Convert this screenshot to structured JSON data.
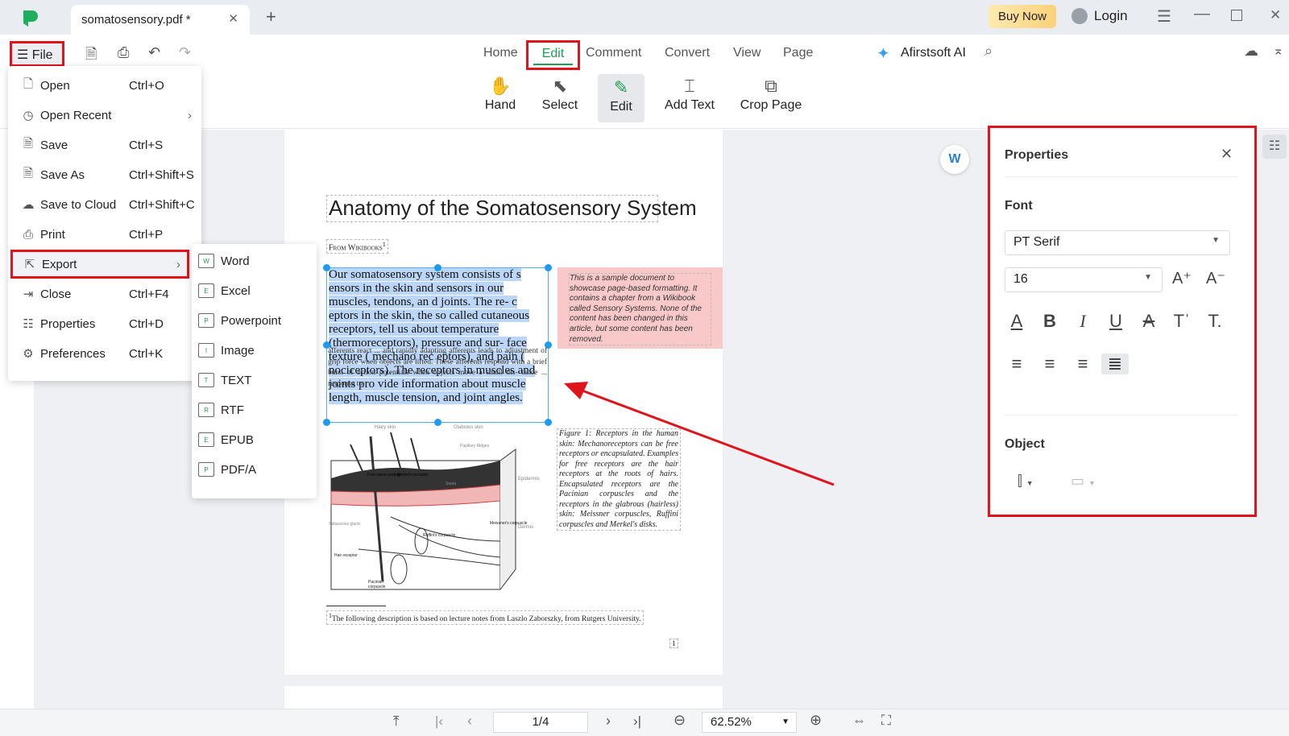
{
  "titlebar": {
    "tab_title": "somatosensory.pdf *",
    "buy_now": "Buy Now",
    "login": "Login"
  },
  "toolbar": {
    "file": "File",
    "nav_tabs": [
      "Home",
      "Edit",
      "Comment",
      "Convert",
      "View",
      "Page"
    ],
    "active_tab": "Edit",
    "ai_label": "Afirstsoft AI",
    "tools": [
      {
        "label": "Hand",
        "icon": "hand-icon"
      },
      {
        "label": "Select",
        "icon": "cursor-icon"
      },
      {
        "label": "Edit",
        "icon": "edit-page-icon"
      },
      {
        "label": "Add Text",
        "icon": "add-text-icon"
      },
      {
        "label": "Crop Page",
        "icon": "crop-icon"
      }
    ]
  },
  "file_menu": [
    {
      "label": "Open",
      "shortcut": "Ctrl+O"
    },
    {
      "label": "Open Recent",
      "shortcut": ""
    },
    {
      "label": "Save",
      "shortcut": "Ctrl+S"
    },
    {
      "label": "Save As",
      "shortcut": "Ctrl+Shift+S"
    },
    {
      "label": "Save to Cloud",
      "shortcut": "Ctrl+Shift+C"
    },
    {
      "label": "Print",
      "shortcut": "Ctrl+P"
    },
    {
      "label": "Export",
      "shortcut": ""
    },
    {
      "label": "Close",
      "shortcut": "Ctrl+F4"
    },
    {
      "label": "Properties",
      "shortcut": "Ctrl+D"
    },
    {
      "label": "Preferences",
      "shortcut": "Ctrl+K"
    }
  ],
  "export_menu": [
    "Word",
    "Excel",
    "Powerpoint",
    "Image",
    "TEXT",
    "RTF",
    "EPUB",
    "PDF/A"
  ],
  "document": {
    "title": "Anatomy of the Somatosensory System",
    "byline": "From Wikibooks",
    "footnote_mark": "1",
    "selected_text": "Our somatosensory system consists of s ensors in the skin and sensors in our muscles, tendons, an d joints. The re- c eptors in the skin, the so called cutaneous receptors, tell us about temperature (thermoreceptors), pressure and sur- face texture ( mechano rec eptors), and pain ( nociceptors). The receptors in muscles and joints pro vide information about muscle length, muscle tension, and joint angles.",
    "underlying_text": "afferents react ... and rapidly adapting afferents leads to adjustment of grip force when objects are lifted. These afferents respond with a brief burst of action potentials when objects move a small dis- tance ... response to",
    "note": "This is a sample document to showcase page-based formatting. It contains a chapter from a Wikibook called Sensory Systems. None of the content has been changed in this article, but some content has been removed.",
    "figure_labels": [
      "Hairy skin",
      "Glabrous skin",
      "Papillary Ridges",
      "Free nerve ending",
      "Merkel's receptor",
      "Septa",
      "Epidermis",
      "Sebaceous gland",
      "Meissner's corpuscle",
      "Ruffini's corpuscle",
      "Dermis",
      "Hair receptor",
      "Pacinian corpuscle"
    ],
    "caption": "Figure 1: Receptors in the human skin: Mechanoreceptors can be free receptors or encapsulated. Examples for free receptors are the hair receptors at the roots of hairs. Encapsulated receptors are the Pacinian corpuscles and the receptors in the glabrous (hairless) skin: Meissner corpuscles, Ruffini corpuscles and Merkel's disks.",
    "footnote": "The following description is based on lecture notes from Laszlo Zaborszky, from Rutgers University.",
    "page_number": "1"
  },
  "properties": {
    "title": "Properties",
    "font_heading": "Font",
    "font_family": "PT Serif",
    "font_size": "16",
    "object_heading": "Object"
  },
  "statusbar": {
    "page": "1/4",
    "zoom": "62.52%"
  },
  "colors": {
    "accent": "#1f9d55",
    "highlight_red": "#e0141c",
    "selection": "#bcd6f7",
    "note_bg": "#f9c9c9"
  }
}
